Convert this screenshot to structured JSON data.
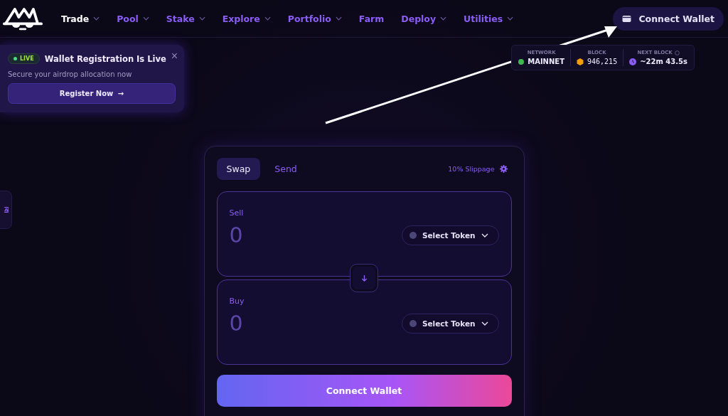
{
  "nav": {
    "items": [
      {
        "label": "Trade",
        "selected": true,
        "dropdown": true
      },
      {
        "label": "Pool",
        "selected": false,
        "dropdown": true
      },
      {
        "label": "Stake",
        "selected": false,
        "dropdown": true
      },
      {
        "label": "Explore",
        "selected": false,
        "dropdown": true
      },
      {
        "label": "Portfolio",
        "selected": false,
        "dropdown": true
      },
      {
        "label": "Farm",
        "selected": false,
        "dropdown": false
      },
      {
        "label": "Deploy",
        "selected": false,
        "dropdown": true
      },
      {
        "label": "Utilities",
        "selected": false,
        "dropdown": true
      }
    ],
    "connect_button": "Connect Wallet"
  },
  "banner": {
    "badge": "LIVE",
    "title": "Wallet Registration Is Live",
    "subtitle": "Secure your airdrop allocation now",
    "button": "Register Now",
    "button_icon": "→",
    "close": "×"
  },
  "stats": [
    {
      "label": "NETWORK",
      "value": "MAINNET",
      "kind": "network",
      "color": "#3fb950"
    },
    {
      "label": "BLOCK",
      "value": "946,215",
      "kind": "block",
      "color": "#f59e0b"
    },
    {
      "label": "NEXT BLOCK",
      "value": "~22m 43.5s",
      "kind": "timer",
      "color": "#8b5cf6"
    }
  ],
  "swap": {
    "tabs": [
      {
        "label": "Swap",
        "selected": true
      },
      {
        "label": "Send",
        "selected": false
      }
    ],
    "slippage": "10% Slippage",
    "panels": [
      {
        "label": "Sell",
        "amount": "0",
        "token": "Select Token"
      },
      {
        "label": "Buy",
        "amount": "0",
        "token": "Select Token"
      }
    ],
    "submit": "Connect Wallet"
  }
}
